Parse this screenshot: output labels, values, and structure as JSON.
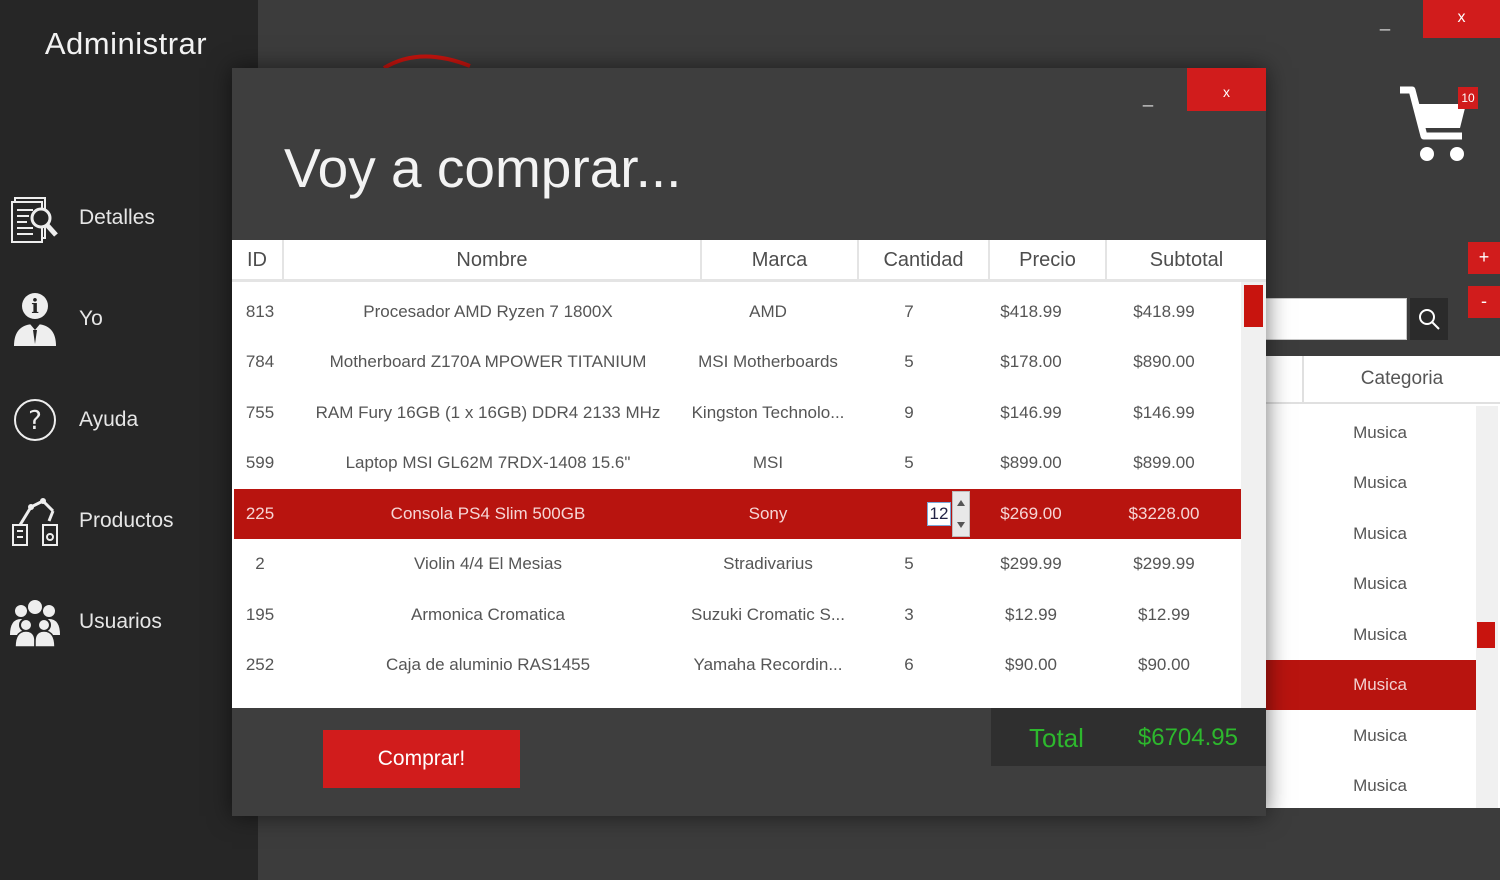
{
  "sidebar": {
    "title": "Administrar",
    "items": [
      {
        "label": "Detalles",
        "icon": "document-search-icon"
      },
      {
        "label": "Yo",
        "icon": "user-info-icon"
      },
      {
        "label": "Ayuda",
        "icon": "help-icon"
      },
      {
        "label": "Productos",
        "icon": "products-icon"
      },
      {
        "label": "Usuarios",
        "icon": "users-icon"
      }
    ]
  },
  "main_window": {
    "minimize_label": "_",
    "close_label": "x",
    "cart_count": "10",
    "add_label": "+",
    "remove_label": "-",
    "search_placeholder": "",
    "table": {
      "column_header": "Categoria",
      "rows": [
        "Musica",
        "Musica",
        "Musica",
        "Musica",
        "Musica",
        "Musica",
        "Musica",
        "Musica"
      ],
      "selected_index": 5
    }
  },
  "modal": {
    "title": "Voy a comprar...",
    "minimize_label": "_",
    "close_label": "x",
    "columns": [
      "ID",
      "Nombre",
      "Marca",
      "Cantidad",
      "Precio",
      "Subtotal"
    ],
    "rows": [
      {
        "id": "813",
        "nombre": "Procesador AMD Ryzen 7 1800X",
        "marca": "AMD",
        "cantidad": "7",
        "precio": "$418.99",
        "subtotal": "$418.99"
      },
      {
        "id": "784",
        "nombre": "Motherboard Z170A MPOWER TITANIUM",
        "marca": "MSI Motherboards",
        "cantidad": "5",
        "precio": "$178.00",
        "subtotal": "$890.00"
      },
      {
        "id": "755",
        "nombre": "RAM Fury 16GB (1 x 16GB) DDR4 2133 MHz",
        "marca": "Kingston Technolo...",
        "cantidad": "9",
        "precio": "$146.99",
        "subtotal": "$146.99"
      },
      {
        "id": "599",
        "nombre": "Laptop MSI GL62M 7RDX-1408 15.6\"",
        "marca": "MSI",
        "cantidad": "5",
        "precio": "$899.00",
        "subtotal": "$899.00"
      },
      {
        "id": "225",
        "nombre": "Consola PS4 Slim 500GB",
        "marca": "Sony",
        "cantidad": "12",
        "precio": "$269.00",
        "subtotal": "$3228.00"
      },
      {
        "id": "2",
        "nombre": "Violin 4/4 El Mesias",
        "marca": "Stradivarius",
        "cantidad": "5",
        "precio": "$299.99",
        "subtotal": "$299.99"
      },
      {
        "id": "195",
        "nombre": "Armonica Cromatica",
        "marca": "Suzuki Cromatic S...",
        "cantidad": "3",
        "precio": "$12.99",
        "subtotal": "$12.99"
      },
      {
        "id": "252",
        "nombre": "Caja de aluminio RAS1455",
        "marca": "Yamaha Recordin...",
        "cantidad": "6",
        "precio": "$90.00",
        "subtotal": "$90.00"
      }
    ],
    "selected_index": 4,
    "buy_label": "Comprar!",
    "total_label": "Total",
    "total_value": "$6704.95"
  },
  "colors": {
    "accent": "#d11c1c",
    "selected_row": "#b8140f",
    "total_text": "#2db82d",
    "sidebar_bg": "#262626",
    "window_bg": "#3e3e3e"
  }
}
